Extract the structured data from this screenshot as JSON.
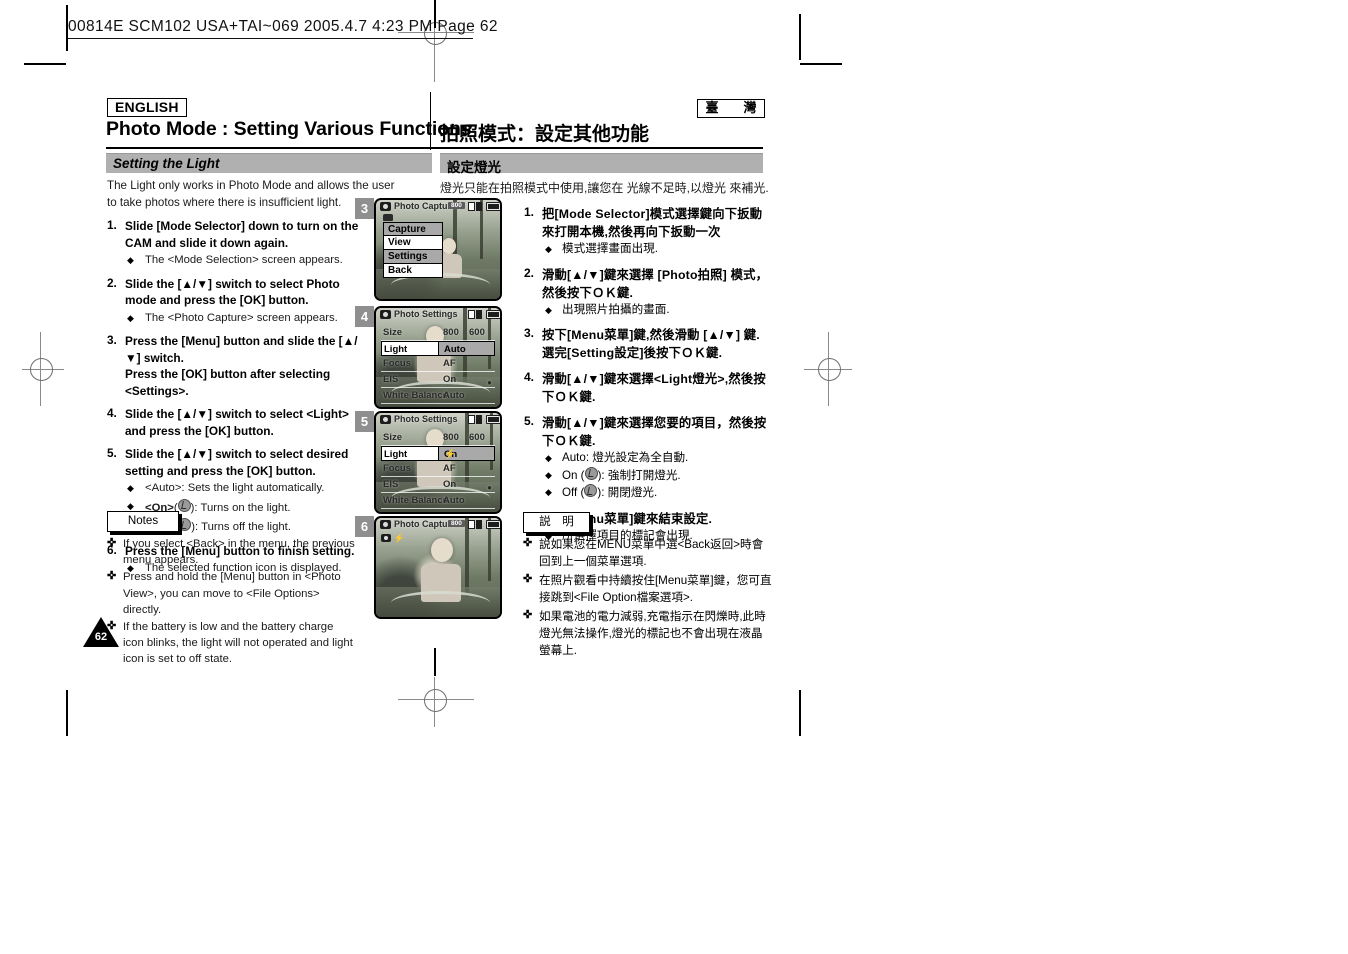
{
  "scan": {
    "header_line": "00814E SCM102 USA+TAI~069 2005.4.7 4:23 PM Page 62"
  },
  "page": {
    "number": "62",
    "language_tag_left": "ENGLISH",
    "language_tag_right": "臺　灣",
    "title_en": "Photo Mode : Setting Various Functions",
    "title_cn": "拍照模式：設定其他功能"
  },
  "english": {
    "section_title": "Setting the Light",
    "intro": "The Light only works in Photo Mode and allows the user to take photos where there is insufficient light.",
    "steps": [
      {
        "num": "1.",
        "text": "Slide [Mode Selector] down to turn on the CAM and slide it down again.",
        "subs": [
          "The <Mode Selection> screen appears."
        ]
      },
      {
        "num": "2.",
        "text": "Slide the [▲/▼] switch to select Photo mode and press the [OK] button.",
        "subs": [
          "The <Photo Capture> screen appears."
        ]
      },
      {
        "num": "3.",
        "text": "Press the [Menu] button and slide the [▲/▼] switch.",
        "text2": "Press the [OK] button after selecting <Settings>.",
        "subs": []
      },
      {
        "num": "4.",
        "text": "Slide the [▲/▼] switch to select <Light> and press the [OK] button.",
        "subs": []
      },
      {
        "num": "5.",
        "text": "Slide the [▲/▼] switch to select desired setting and press the [OK] button.",
        "subs": [
          "<Auto>: Sets the light automatically.",
          "<On>(    ): Turns on the light.",
          "<Off>(    ): Turns off the light."
        ]
      },
      {
        "num": "6.",
        "text": "Press the [Menu] button to finish setting.",
        "subs": [
          "The selected function icon is displayed."
        ]
      }
    ],
    "notes_label": "Notes",
    "notes": [
      "If you select <Back> in the menu, the previous menu appears.",
      "Press and hold the [Menu] button in <Photo View>, you can move to <File Options> directly.",
      "If the battery is low and the battery charge icon blinks, the light will not operated and light icon is set to off state."
    ]
  },
  "chinese": {
    "section_title": "設定燈光",
    "intro": "燈光只能在拍照模式中使用,讓您在 光線不足時,以燈光 來補光.",
    "steps": [
      {
        "num": "1.",
        "text": "把[Mode Selector]模式選擇鍵向下扳動來打開本機,然後再向下扳動一次",
        "subs": [
          "模式選擇畫面出現."
        ]
      },
      {
        "num": "2.",
        "text": "滑動[▲/▼]鍵來選擇 [Photo拍照] 模式，然後按下ＯＫ鍵.",
        "subs": [
          "出現照片拍攝的畫面."
        ]
      },
      {
        "num": "3.",
        "text": "按下[Menu菜單]鍵,然後滑動 [▲/▼] 鍵.",
        "text2": "選完[Setting設定]後按下ＯＫ鍵.",
        "subs": []
      },
      {
        "num": "4.",
        "text": "滑動[▲/▼]鍵來選擇<Light燈光>,然後按下ＯＫ鍵.",
        "subs": []
      },
      {
        "num": "5.",
        "text": "滑動[▲/▼]鍵來選擇您要的項目，然後按下ＯＫ鍵.",
        "subs": [
          "Auto: 燈光設定為全自動.",
          "On (    ): 強制打開燈光.",
          "Off (    ): 開閉燈光."
        ]
      },
      {
        "num": "6.",
        "text": "按下[Menu菜單]鍵來結束設定.",
        "subs": [
          "所選擇項目的標記會出現."
        ]
      }
    ],
    "notes_label": "説　明",
    "notes": [
      "説如果您在MENU菜單中選<Back返回>時會回到上一個菜單選項.",
      "在照片觀看中持續按住[Menu菜單]鍵，您可直接跳到<File Option檔案選項>.",
      "如果電池的電力減弱,充電指示在閃爍時,此時燈光無法操作,燈光的標記也不會出現在液晶螢幕上."
    ]
  },
  "screenshots": [
    {
      "index": "3",
      "title": "Photo Capture",
      "resolution": "800",
      "type": "menu",
      "menu_items": [
        {
          "label": "Capture",
          "selected": true
        },
        {
          "label": "View",
          "selected": false
        },
        {
          "label": "Settings",
          "selected": true
        },
        {
          "label": "Back",
          "selected": false
        }
      ]
    },
    {
      "index": "4",
      "title": "Photo Settings",
      "type": "settings",
      "rows": [
        {
          "label": "Size",
          "value": "800",
          "value2": "600",
          "highlight": false
        },
        {
          "label": "Light",
          "value": "Auto",
          "highlight": true,
          "bolt": ""
        },
        {
          "label": "Focus",
          "value": "AF",
          "highlight": false
        },
        {
          "label": "EIS",
          "value": "On",
          "highlight": false,
          "ricon": "●"
        },
        {
          "label": "White Balance",
          "value": "Auto",
          "highlight": false
        }
      ]
    },
    {
      "index": "5",
      "title": "Photo Settings",
      "type": "settings",
      "rows": [
        {
          "label": "Size",
          "value": "800",
          "value2": "600",
          "highlight": false
        },
        {
          "label": "Light",
          "value": "On",
          "highlight": true,
          "bolt": "⚡"
        },
        {
          "label": "Focus",
          "value": "AF",
          "highlight": false
        },
        {
          "label": "EIS",
          "value": "On",
          "highlight": false,
          "ricon": "●"
        },
        {
          "label": "White Balance",
          "value": "Auto",
          "highlight": false
        }
      ]
    },
    {
      "index": "6",
      "title": "Photo Capture",
      "resolution": "800",
      "type": "preview"
    }
  ]
}
